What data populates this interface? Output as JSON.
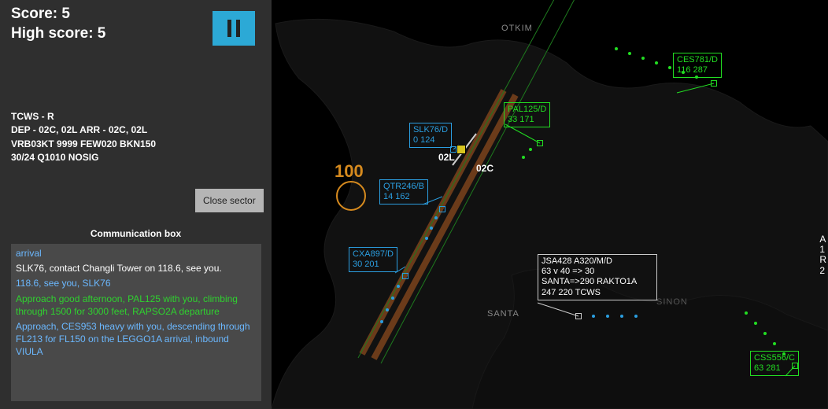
{
  "scores": {
    "score_label": "Score: 5",
    "highscore_label": "High score: 5"
  },
  "atis": {
    "line1": "TCWS - R",
    "line2": "DEP - 02C, 02L    ARR - 02C, 02L",
    "line3": "VRB03KT 9999 FEW020 BKN150",
    "line4": "30/24 Q1010 NOSIG"
  },
  "buttons": {
    "close_sector": "Close sector"
  },
  "comm": {
    "title": "Communication box",
    "messages": [
      {
        "text": "arrival",
        "color": "c-blue"
      },
      {
        "text": "SLK76, contact Changli Tower on 118.6, see you.",
        "color": "c-white"
      },
      {
        "text": "118.6, see you, SLK76",
        "color": "c-blue"
      },
      {
        "text": "Approach good afternoon, PAL125 with you, climbing through 1500 for 3000 feet, RAPSO2A departure",
        "color": "c-green"
      },
      {
        "text": "Approach, CES953 heavy with you, descending through FL213 for FL150 on the LEGGO1A arrival, inbound VIULA",
        "color": "c-blue"
      }
    ]
  },
  "fixes": {
    "otkim": "OTKIM",
    "santa": "SANTA",
    "sinon": "SINON"
  },
  "runways": {
    "l": "02L",
    "c": "02C"
  },
  "big_number": "100",
  "edge": {
    "line1": "A",
    "line2": "1",
    "line3": "R",
    "line4": "2"
  },
  "aircraft": {
    "ces781": {
      "line1": "CES781/D",
      "line2": "116  287"
    },
    "pal125": {
      "line1": "PAL125/D",
      "line2": "33  171"
    },
    "slk76": {
      "line1": "SLK76/D",
      "line2": "0  124"
    },
    "qtr246": {
      "line1": "QTR246/B",
      "line2": "14  162"
    },
    "cxa897": {
      "line1": "CXA897/D",
      "line2": "30  201"
    },
    "css556": {
      "line1": "CSS556/C",
      "line2": "63  281"
    },
    "jsa428": {
      "line1": "JSA428 A320/M/D",
      "line2": "63 v 40 => 30",
      "line3": "SANTA=>290 RAKTO1A",
      "line4": "247 220 TCWS"
    }
  }
}
